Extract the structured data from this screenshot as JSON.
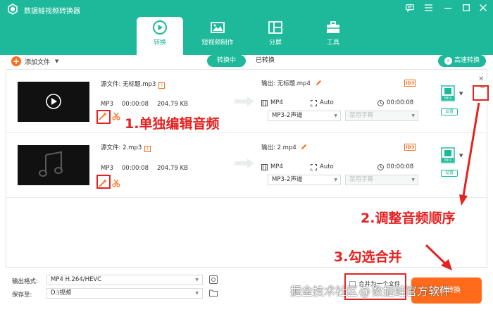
{
  "window": {
    "title": "数据蛙视频转换器",
    "accent": "#1db99a",
    "highlight": "#ff6b1a",
    "annotation_color": "#e52222"
  },
  "main_tabs": [
    {
      "label": "转换",
      "icon": "convert-icon",
      "active": true
    },
    {
      "label": "短视频制作",
      "icon": "video-making-icon",
      "active": false
    },
    {
      "label": "分屏",
      "icon": "split-screen-icon",
      "active": false
    },
    {
      "label": "工具",
      "icon": "toolbox-icon",
      "active": false
    }
  ],
  "toolbar": {
    "add_file_label": "添加文件",
    "segments": [
      "转换中",
      "已转换"
    ],
    "active_segment": "转换中",
    "turbo_label": "高速转换"
  },
  "files": [
    {
      "source_label": "源文件: 无标题.mp3",
      "format": "MP3",
      "duration": "00:00:08",
      "size": "204.79 KB",
      "output_label": "输出: 无标题.mp4",
      "id3": "ID3",
      "out_format": "MP4",
      "out_resolution": "Auto",
      "out_duration": "00:00:08",
      "audio_track": "MP3-2声道",
      "subtitle": "禁用字幕",
      "settings_label": "设置",
      "fmt_badge": "MP4"
    },
    {
      "source_label": "源文件: 2.mp3",
      "format": "MP3",
      "duration": "00:00:08",
      "size": "204.79 KB",
      "output_label": "输出: 2.mp4",
      "id3": "ID3",
      "out_format": "MP4",
      "out_resolution": "Auto",
      "out_duration": "00:00:08",
      "audio_track": "MP3-2声道",
      "subtitle": "禁用字幕",
      "settings_label": "设置",
      "fmt_badge": "MP4"
    }
  ],
  "bottom": {
    "output_format_label": "输出格式:",
    "output_format_value": "MP4 H.264/HEVC",
    "save_to_label": "保存至:",
    "save_to_value": "D:\\视频",
    "merge_label": "合并为一个文件",
    "convert_all_label": "全部转换"
  },
  "annotations": {
    "step1": "1.单独编辑音频",
    "step2": "2.调整音频顺序",
    "step3": "3.勾选合并"
  },
  "watermark": {
    "left": "掘金技术社区",
    "at": "@",
    "right": "数据蛙官方软件"
  }
}
